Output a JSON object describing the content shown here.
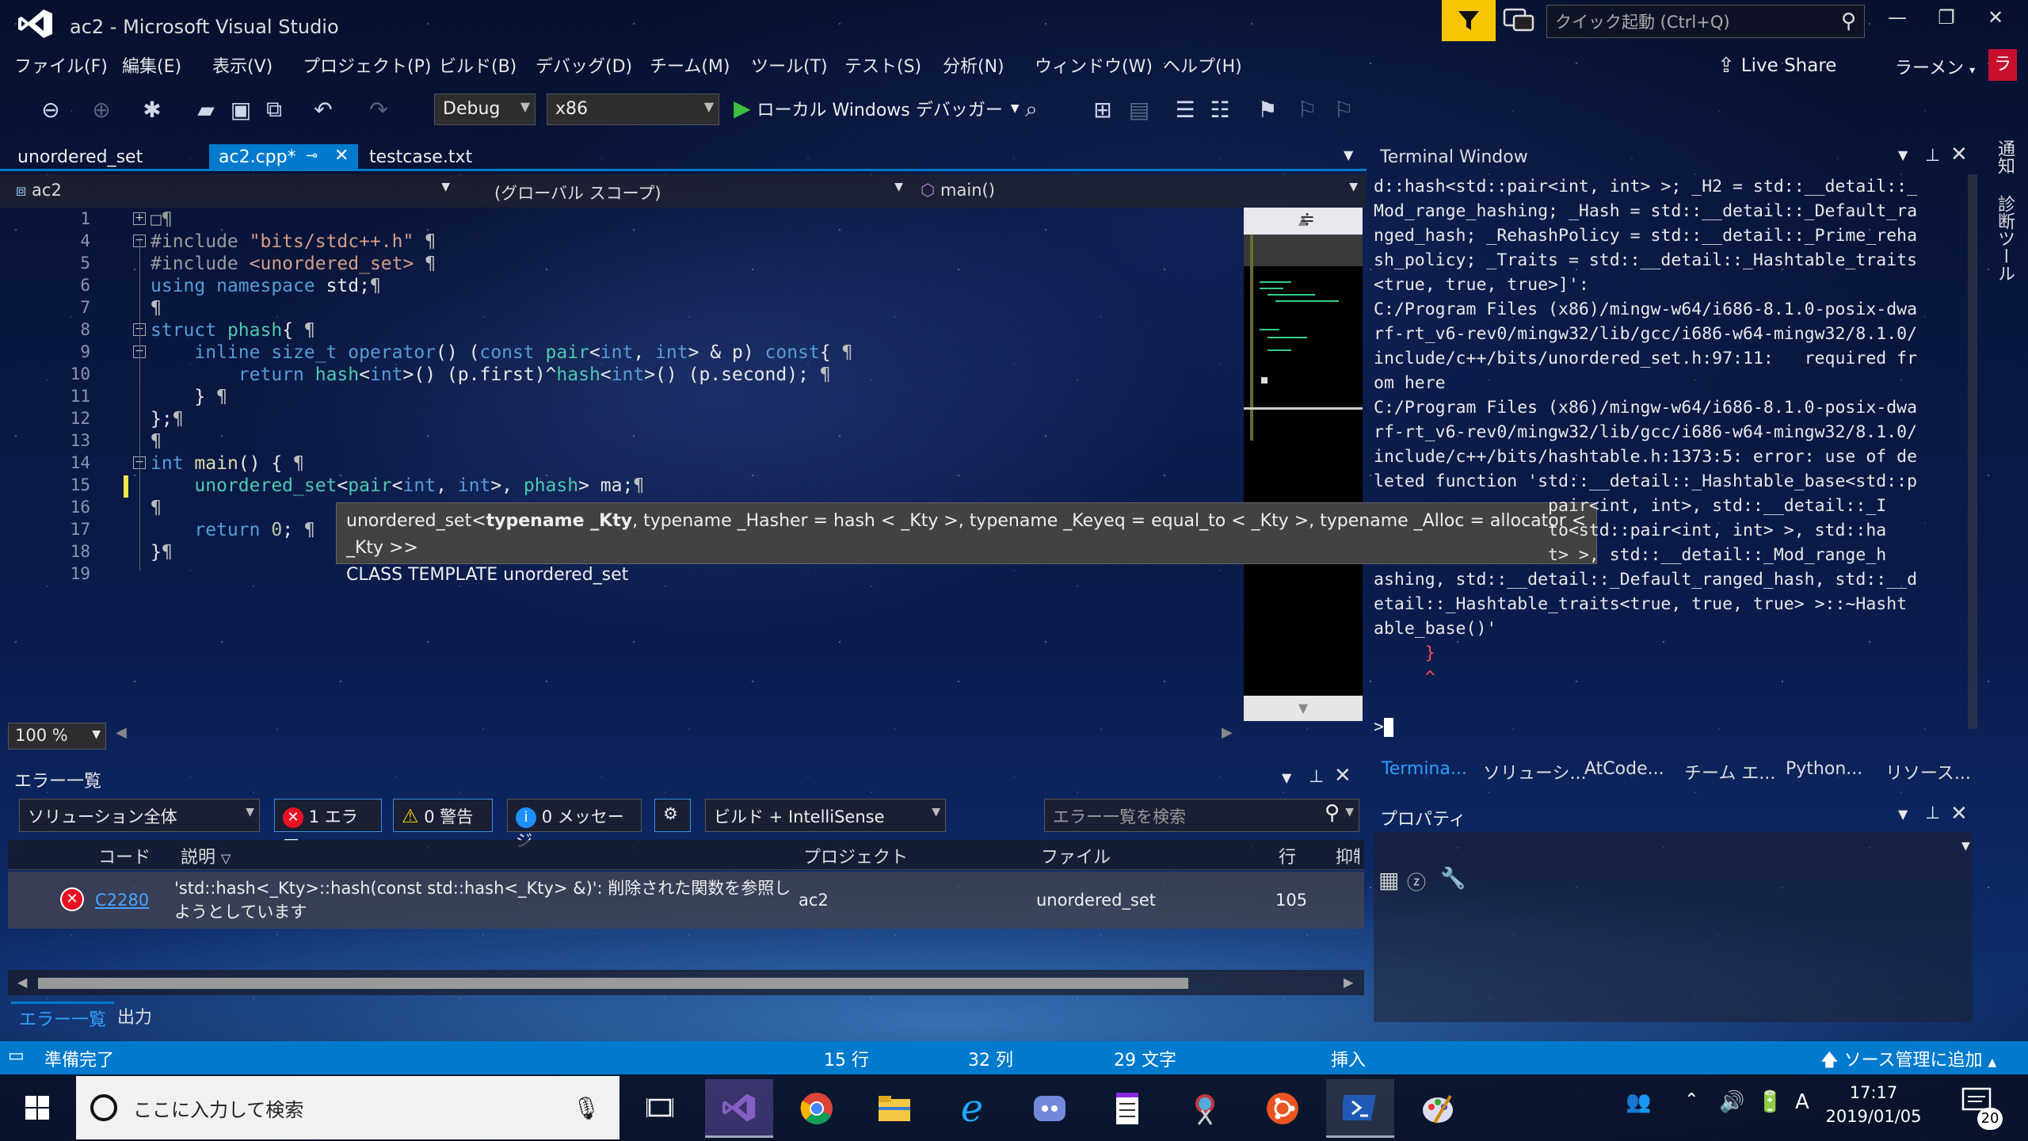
{
  "window": {
    "title": "ac2 - Microsoft Visual Studio"
  },
  "quick_launch": {
    "placeholder": "クイック起動 (Ctrl+Q)"
  },
  "menu": [
    "ファイル(F)",
    "編集(E)",
    "表示(V)",
    "プロジェクト(P)",
    "ビルド(B)",
    "デバッグ(D)",
    "チーム(M)",
    "ツール(T)",
    "テスト(S)",
    "分析(N)",
    "ウィンドウ(W)",
    "ヘルプ(H)"
  ],
  "liveshare": "Live Share",
  "user": {
    "name": "ラーメン",
    "initial": "ラ"
  },
  "toolbar": {
    "config": "Debug",
    "platform": "x86",
    "debugger": "ローカル Windows デバッガー"
  },
  "tabs": [
    "unordered_set",
    "ac2.cpp*",
    "testcase.txt"
  ],
  "nav": {
    "project": "ac2",
    "scope": "(グローバル スコープ)",
    "member": "main()"
  },
  "lines": [
    "1",
    "4",
    "5",
    "6",
    "7",
    "8",
    "9",
    "10",
    "11",
    "12",
    "13",
    "14",
    "15",
    "16",
    "17",
    "18",
    "19"
  ],
  "tooltip": {
    "sig_pre": "unordered_set<",
    "sig_kw1": "typename _Kty",
    "sig_rest": ", typename _Hasher = hash < _Kty >, typename _Keyeq = equal_to < _Kty >, typename _Alloc = allocator < _Kty >>",
    "kind": "CLASS TEMPLATE unordered_set"
  },
  "zoom": "100 %",
  "terminal": {
    "title": "Terminal Window",
    "lines": [
      "d::hash<std::pair<int, int> >; _H2 = std::__detail::_",
      "Mod_range_hashing; _Hash = std::__detail::_Default_ra",
      "nged_hash; _RehashPolicy = std::__detail::_Prime_reha",
      "sh_policy; _Traits = std::__detail::_Hashtable_traits",
      "<true, true, true>]':",
      "C:/Program Files (x86)/mingw-w64/i686-8.1.0-posix-dwa",
      "rf-rt_v6-rev0/mingw32/lib/gcc/i686-w64-mingw32/8.1.0/",
      "include/c++/bits/unordered_set.h:97:11:   required fr",
      "om here",
      "C:/Program Files (x86)/mingw-w64/i686-8.1.0-posix-dwa",
      "rf-rt_v6-rev0/mingw32/lib/gcc/i686-w64-mingw32/8.1.0/",
      "include/c++/bits/hashtable.h:1373:5: error: use of de",
      "leted function 'std::__detail::_Hashtable_base<std::p",
      "                 pair<int, int>, std::__detail::_I",
      "                 to<std::pair<int, int> >, std::ha",
      "                 t> >, std::__detail::_Mod_range_h",
      "ashing, std::__detail::_Default_ranged_hash, std::__d",
      "etail::_Hashtable_traits<true, true, true> >::~Hasht",
      "able_base()'",
      "     }",
      "     ^",
      "",
      ">"
    ]
  },
  "terminal_tabs": [
    "Termina...",
    "ソリューシ...",
    "AtCode...",
    "チーム エ...",
    "Python...",
    "リソース..."
  ],
  "properties": {
    "title": "プロパティ"
  },
  "errorlist": {
    "title": "エラー一覧",
    "scope": "ソリューション全体",
    "errors": "1 エラー",
    "warnings": "0 警告",
    "messages": "0 メッセージ",
    "build": "ビルド + IntelliSense",
    "search_placeholder": "エラー一覧を検索",
    "columns": [
      "コード",
      "説明",
      "プロジェクト",
      "ファイル",
      "行",
      "抑制"
    ],
    "rows": [
      {
        "code": "C2280",
        "desc": "'std::hash<_Kty>::hash(const std::hash<_Kty> &)': 削除された関数を参照しようとしています",
        "project": "ac2",
        "file": "unordered_set",
        "line": "105"
      }
    ]
  },
  "bottom_tabs": [
    "エラー一覧",
    "出力"
  ],
  "status": {
    "ready": "準備完了",
    "line": "15 行",
    "col": "32 列",
    "ch": "29 文字",
    "mode": "挿入",
    "scm": "ソース管理に追加"
  },
  "taskbar": {
    "search_placeholder": "ここに入力して検索",
    "time": "17:17",
    "date": "2019/01/05",
    "notifications": "20"
  },
  "colors": {
    "accent": "#007acc",
    "error": "#e81123",
    "warning": "#f5c600"
  }
}
